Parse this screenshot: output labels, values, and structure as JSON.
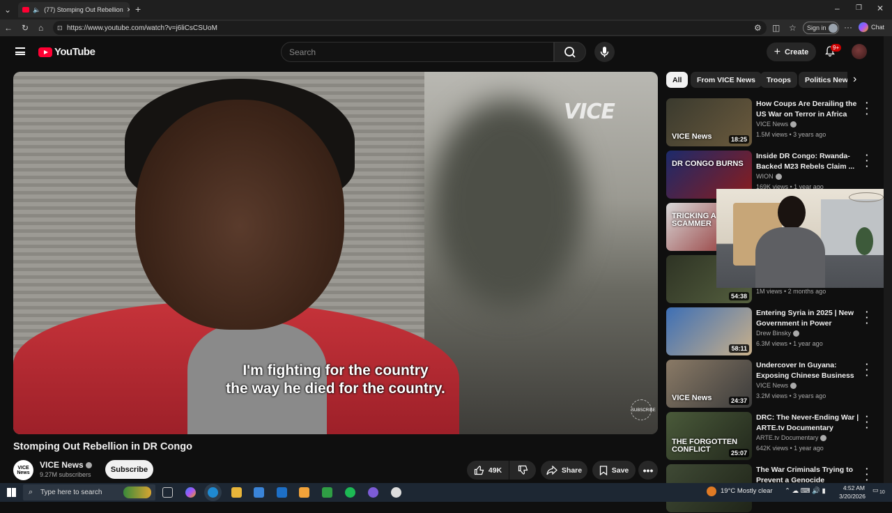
{
  "browser": {
    "tab_title": "(77) Stomping Out Rebellion",
    "url": "https://www.youtube.com/watch?v=j6liCsCSUoM",
    "sign_in": "Sign in",
    "chat": "Chat"
  },
  "youtube": {
    "logo": "YouTube",
    "search_placeholder": "Search",
    "create_label": "Create",
    "notifications_badge": "9+"
  },
  "video": {
    "watermark": "VICE",
    "caption_line1": "I'm fighting for the country",
    "caption_line2": "the way he died for the country.",
    "subscribe_watermark": "SUBSCRIBE",
    "title": "Stomping Out Rebellion in DR Congo",
    "channel_avatar_text": "VICE News",
    "channel": "VICE News",
    "subscribers": "9.27M subscribers",
    "subscribe_label": "Subscribe",
    "likes": "49K",
    "share_label": "Share",
    "save_label": "Save"
  },
  "chips": [
    "All",
    "From VICE News",
    "Troops",
    "Politics New"
  ],
  "recommendations": [
    {
      "title": "How Coups Are Derailing the US War on Terror in Africa",
      "channel": "VICE News",
      "verified": true,
      "meta": "1.5M views • 3 years ago",
      "duration": "18:25",
      "thumb_text": "VICE News",
      "colors": [
        "#3a3a2e",
        "#6b5a3d"
      ]
    },
    {
      "title": "Inside DR Congo: Rwanda-Backed M23 Rebels Claim ...",
      "channel": "WION",
      "verified": true,
      "meta": "169K views • 1 year ago",
      "duration": "",
      "thumb_text": "DR CONGO BURNS",
      "colors": [
        "#1c2a6b",
        "#8a1c1c"
      ]
    },
    {
      "title": "",
      "channel": "",
      "verified": false,
      "meta": "",
      "duration": "",
      "thumb_text": "TRICKING A SCAMMER",
      "colors": [
        "#d8d8d8",
        "#8a2020"
      ]
    },
    {
      "title": "",
      "channel": "",
      "verified": false,
      "meta": "1M views • 2 months ago",
      "duration": "54:38",
      "thumb_text": "",
      "colors": [
        "#2e3324",
        "#55603f"
      ]
    },
    {
      "title": "Entering Syria in 2025 | New Government in Power",
      "channel": "Drew Binsky",
      "verified": true,
      "meta": "6.3M views • 1 year ago",
      "duration": "58:11",
      "thumb_text": "",
      "colors": [
        "#3d6fb5",
        "#c9b08a"
      ]
    },
    {
      "title": "Undercover In Guyana: Exposing Chinese Business in South ...",
      "channel": "VICE News",
      "verified": true,
      "meta": "3.2M views • 3 years ago",
      "duration": "24:37",
      "thumb_text": "VICE News",
      "colors": [
        "#8a7a66",
        "#3b3b3b"
      ]
    },
    {
      "title": "DRC: The Never-Ending War | ARTE.tv Documentary",
      "channel": "ARTE.tv Documentary",
      "verified": true,
      "meta": "642K views • 1 year ago",
      "duration": "25:07",
      "thumb_text": "THE FORGOTTEN CONFLICT",
      "colors": [
        "#4a5a3a",
        "#22281c"
      ]
    },
    {
      "title": "The War Criminals Trying to Prevent a Genocide",
      "channel": "",
      "verified": false,
      "meta": "",
      "duration": "",
      "thumb_text": "",
      "colors": [
        "#3f4a35",
        "#1f2418"
      ]
    }
  ],
  "taskbar": {
    "search_placeholder": "Type here to search",
    "weather": "19°C  Mostly clear",
    "time": "4:52 AM",
    "date": "3/20/2026",
    "notif_count": "10"
  }
}
